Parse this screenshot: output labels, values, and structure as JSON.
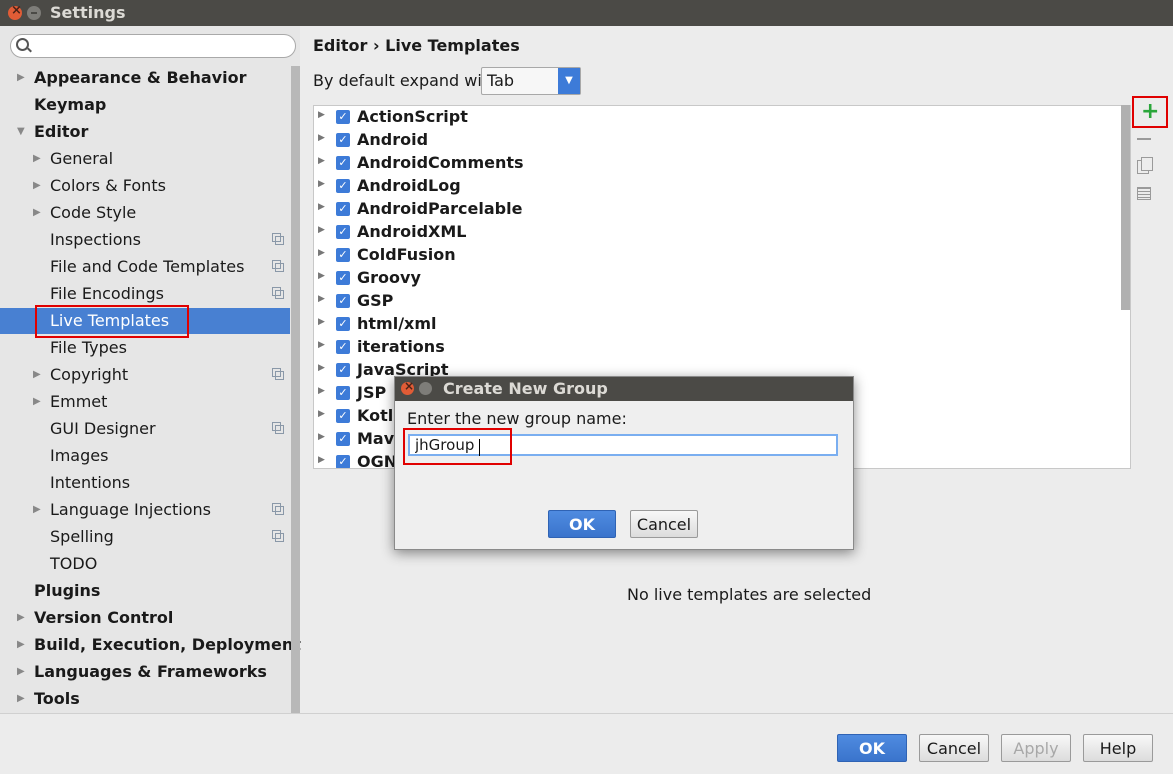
{
  "window": {
    "title": "Settings"
  },
  "search": {
    "placeholder": "",
    "value": ""
  },
  "sidebar": {
    "items": [
      {
        "label": "Appearance & Behavior",
        "level": 0,
        "bold": true,
        "arrow": "▶"
      },
      {
        "label": "Keymap",
        "level": 0,
        "bold": true,
        "arrow": ""
      },
      {
        "label": "Editor",
        "level": 0,
        "bold": true,
        "arrow": "▼"
      },
      {
        "label": "General",
        "level": 1,
        "arrow": "▶"
      },
      {
        "label": "Colors & Fonts",
        "level": 1,
        "arrow": "▶"
      },
      {
        "label": "Code Style",
        "level": 1,
        "arrow": "▶"
      },
      {
        "label": "Inspections",
        "level": 1,
        "arrow": "",
        "project_icon": true
      },
      {
        "label": "File and Code Templates",
        "level": 1,
        "arrow": "",
        "project_icon": true
      },
      {
        "label": "File Encodings",
        "level": 1,
        "arrow": "",
        "project_icon": true
      },
      {
        "label": "Live Templates",
        "level": 1,
        "arrow": "",
        "selected": true
      },
      {
        "label": "File Types",
        "level": 1,
        "arrow": ""
      },
      {
        "label": "Copyright",
        "level": 1,
        "arrow": "▶",
        "project_icon": true
      },
      {
        "label": "Emmet",
        "level": 1,
        "arrow": "▶"
      },
      {
        "label": "GUI Designer",
        "level": 1,
        "arrow": "",
        "project_icon": true
      },
      {
        "label": "Images",
        "level": 1,
        "arrow": ""
      },
      {
        "label": "Intentions",
        "level": 1,
        "arrow": ""
      },
      {
        "label": "Language Injections",
        "level": 1,
        "arrow": "▶",
        "project_icon": true
      },
      {
        "label": "Spelling",
        "level": 1,
        "arrow": "",
        "project_icon": true
      },
      {
        "label": "TODO",
        "level": 1,
        "arrow": ""
      },
      {
        "label": "Plugins",
        "level": 0,
        "bold": true,
        "arrow": ""
      },
      {
        "label": "Version Control",
        "level": 0,
        "bold": true,
        "arrow": "▶"
      },
      {
        "label": "Build, Execution, Deployment",
        "level": 0,
        "bold": true,
        "arrow": "▶"
      },
      {
        "label": "Languages & Frameworks",
        "level": 0,
        "bold": true,
        "arrow": "▶"
      },
      {
        "label": "Tools",
        "level": 0,
        "bold": true,
        "arrow": "▶"
      }
    ]
  },
  "main": {
    "breadcrumb": "Editor › Live Templates",
    "expand_label": "By default expand with",
    "expand_value": "Tab",
    "templates": [
      {
        "label": "ActionScript",
        "checked": true
      },
      {
        "label": "Android",
        "checked": true
      },
      {
        "label": "AndroidComments",
        "checked": true
      },
      {
        "label": "AndroidLog",
        "checked": true
      },
      {
        "label": "AndroidParcelable",
        "checked": true
      },
      {
        "label": "AndroidXML",
        "checked": true
      },
      {
        "label": "ColdFusion",
        "checked": true
      },
      {
        "label": "Groovy",
        "checked": true
      },
      {
        "label": "GSP",
        "checked": true
      },
      {
        "label": "html/xml",
        "checked": true
      },
      {
        "label": "iterations",
        "checked": true
      },
      {
        "label": "JavaScript",
        "checked": true
      },
      {
        "label": "JSP",
        "checked": true
      },
      {
        "label": "Kotlin",
        "checked": true
      },
      {
        "label": "Maven",
        "checked": true
      },
      {
        "label": "OGNL",
        "checked": true
      }
    ],
    "no_selection_text": "No live templates are selected"
  },
  "toolbar": {
    "add": "+",
    "add_icon": "plus-icon",
    "remove_icon": "minus-icon",
    "copy_icon": "copy-icon",
    "edit_icon": "edit-icon"
  },
  "dialog": {
    "title": "Create New Group",
    "prompt": "Enter the new group name:",
    "input_value": "jhGroup",
    "ok_label": "OK",
    "cancel_label": "Cancel"
  },
  "footer": {
    "ok_label": "OK",
    "cancel_label": "Cancel",
    "apply_label": "Apply",
    "help_label": "Help"
  },
  "colors": {
    "accent": "#3d7bd8",
    "selection": "#4880d2",
    "highlight_box": "#e00000",
    "add_green": "#2aa63a"
  }
}
